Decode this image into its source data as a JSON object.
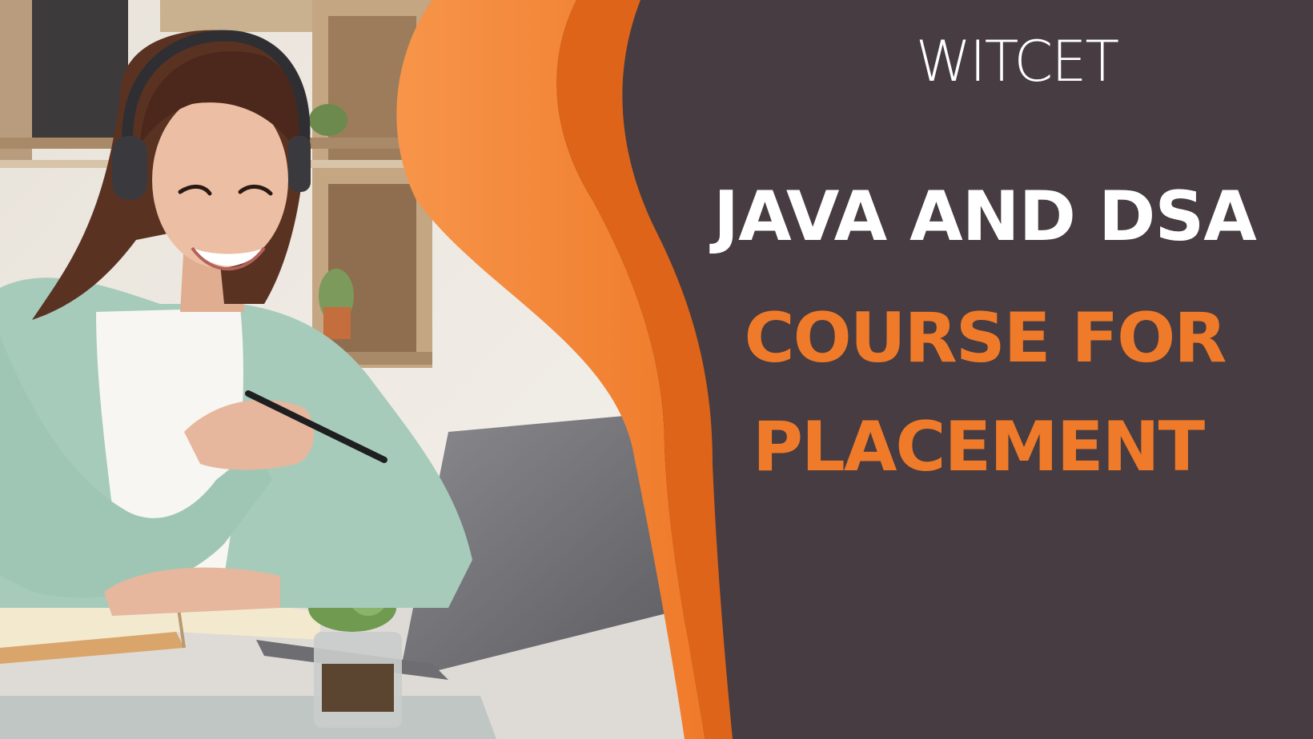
{
  "brand": {
    "name": "WITCET"
  },
  "headline": {
    "line1": "JAVA AND DSA",
    "line2": "COURSE FOR",
    "line3": "PLACEMENT"
  },
  "colors": {
    "background": "#463c41",
    "accent_orange": "#ef7a2a",
    "accent_orange_light": "#f7954a",
    "accent_orange_dark": "#dd6418",
    "text_white": "#ffffff"
  },
  "photo": {
    "subject": "student-with-headphones-and-laptop"
  }
}
